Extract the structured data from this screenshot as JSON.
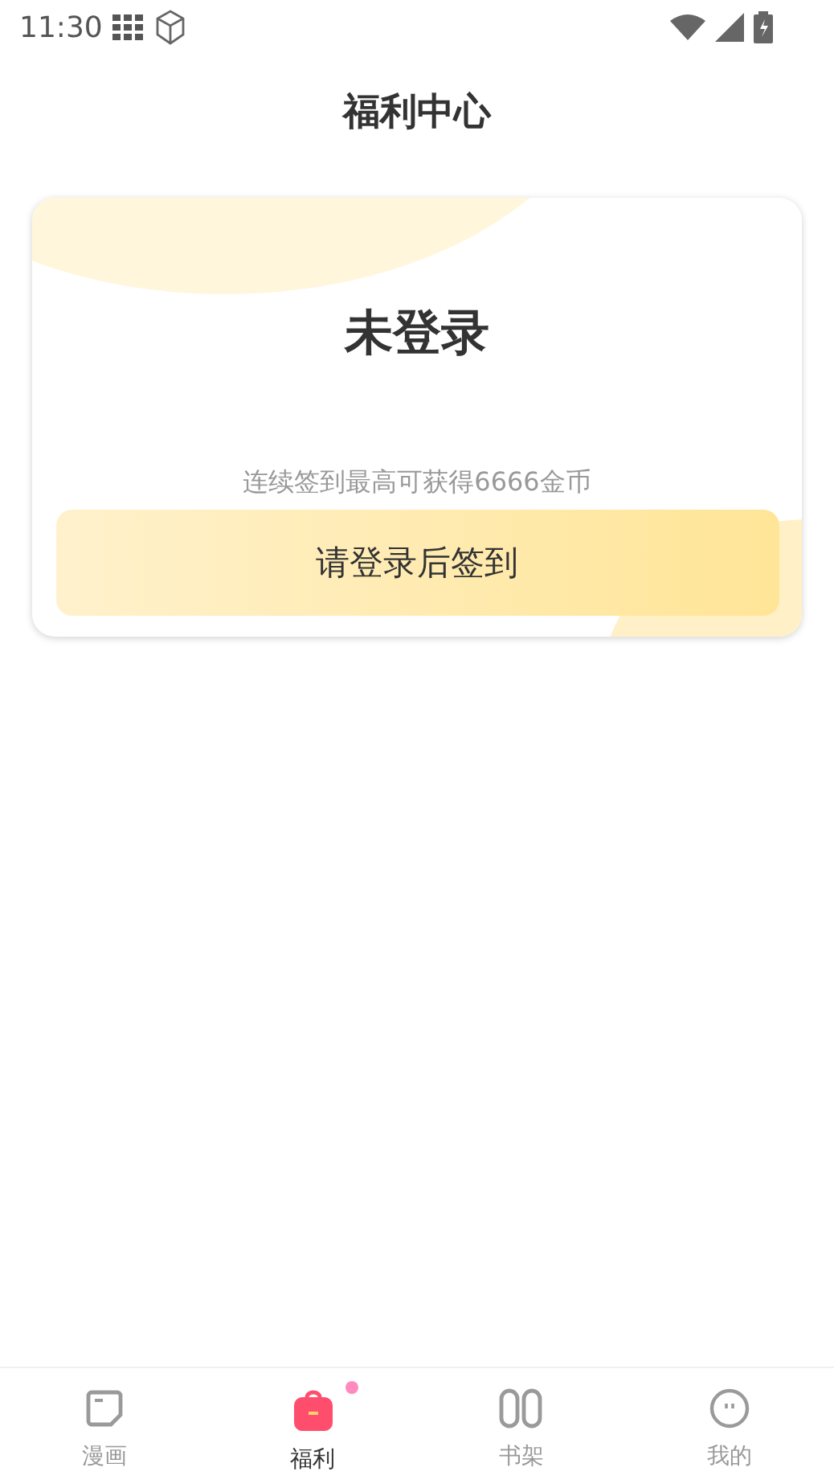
{
  "status_bar": {
    "time": "11:30"
  },
  "header": {
    "title": "福利中心"
  },
  "signin_card": {
    "status": "未登录",
    "hint": "连续签到最高可获得6666金币",
    "button": "请登录后签到"
  },
  "tab_bar": [
    {
      "label": "漫画",
      "kind": "comic",
      "selected": false,
      "dot": false
    },
    {
      "label": "福利",
      "kind": "gift",
      "selected": true,
      "dot": true
    },
    {
      "label": "书架",
      "kind": "shelf",
      "selected": false,
      "dot": false
    },
    {
      "label": "我的",
      "kind": "me",
      "selected": false,
      "dot": false
    }
  ]
}
